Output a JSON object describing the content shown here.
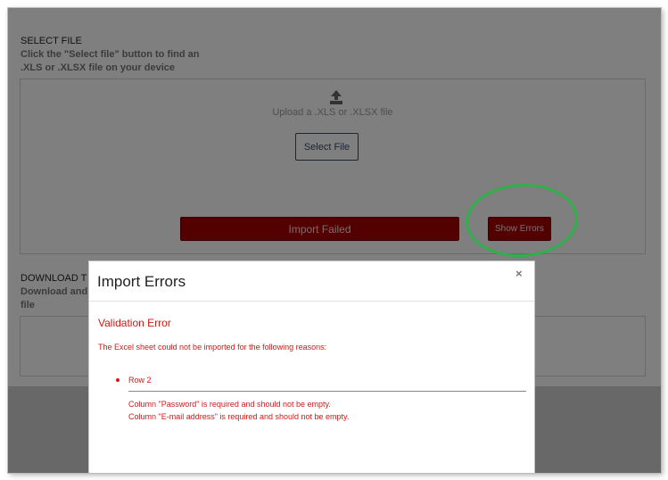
{
  "select_file": {
    "title": "SELECT FILE",
    "description": "Click the \"Select file\" button to find an .XLS or .XLSX file on your device",
    "upload_text": "Upload a .XLS or .XLSX file",
    "select_button": "Select File",
    "import_status": "Import Failed",
    "show_errors_button": "Show Errors"
  },
  "download": {
    "title": "DOWNLOAD T",
    "description_1": "Download and",
    "description_2": "file"
  },
  "modal": {
    "title": "Import Errors",
    "close_icon": "×",
    "validation_title": "Validation Error",
    "reason": "The Excel sheet could not be imported for the following reasons:",
    "rows": [
      {
        "label": "Row 2",
        "errors": [
          "Column \"Password\" is required and should not be empty.",
          "Column \"E-mail address\" is required and should not be empty."
        ]
      }
    ]
  },
  "colors": {
    "error_red": "#d21818",
    "failed_button": "#a50000",
    "highlight_circle": "#2fb04a",
    "select_button_border": "#2f4d6b"
  },
  "icons": [
    "upload-icon",
    "close-icon"
  ]
}
